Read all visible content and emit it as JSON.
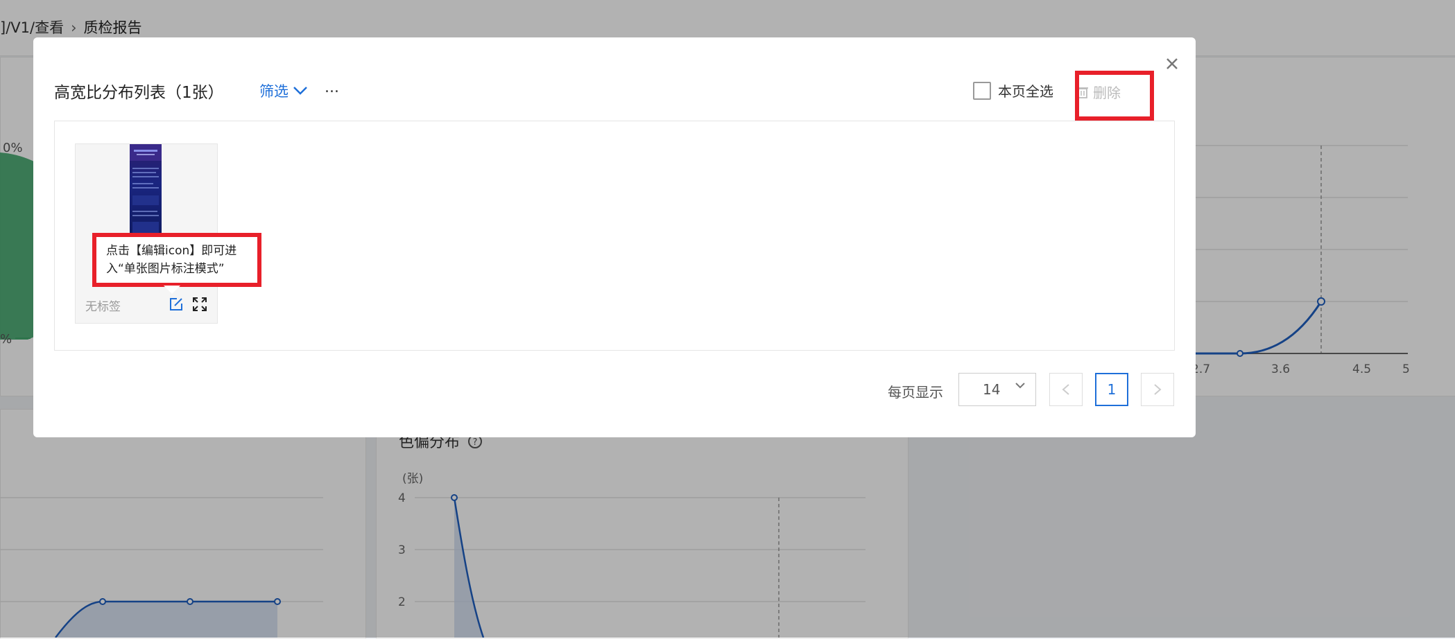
{
  "breadcrumb": {
    "prefix": "]/V1/查看",
    "current": "质检报告"
  },
  "background": {
    "pie_labels": {
      "top": "0%",
      "bottom": "%"
    },
    "right_chart": {
      "x_ticks": [
        "2.7",
        "3.6",
        "4.5",
        "5"
      ]
    },
    "left_chart": {},
    "middle_chart": {
      "title": "色偏分布",
      "unit": "(张)",
      "y_ticks": [
        "4",
        "3",
        "2"
      ]
    }
  },
  "modal": {
    "title": "高宽比分布列表（1张）",
    "filter_label": "筛选",
    "more_label": "...",
    "select_all_label": "本页全选",
    "delete_label": "删除",
    "items": [
      {
        "label": "无标签"
      }
    ],
    "tooltip_text": "点击【编辑icon】即可进入“单张图片标注模式”",
    "pagination": {
      "per_page_label": "每页显示",
      "per_page_value": "14",
      "current_page": "1"
    }
  },
  "colors": {
    "accent": "#1e6fd9",
    "highlight": "#e8202a",
    "pie": "#3fa56a"
  },
  "icons": [
    "close-icon",
    "chevron-down-icon",
    "checkbox-icon",
    "trash-icon",
    "edit-icon",
    "expand-icon",
    "chevron-left-icon",
    "chevron-right-icon",
    "help-circle-icon"
  ]
}
